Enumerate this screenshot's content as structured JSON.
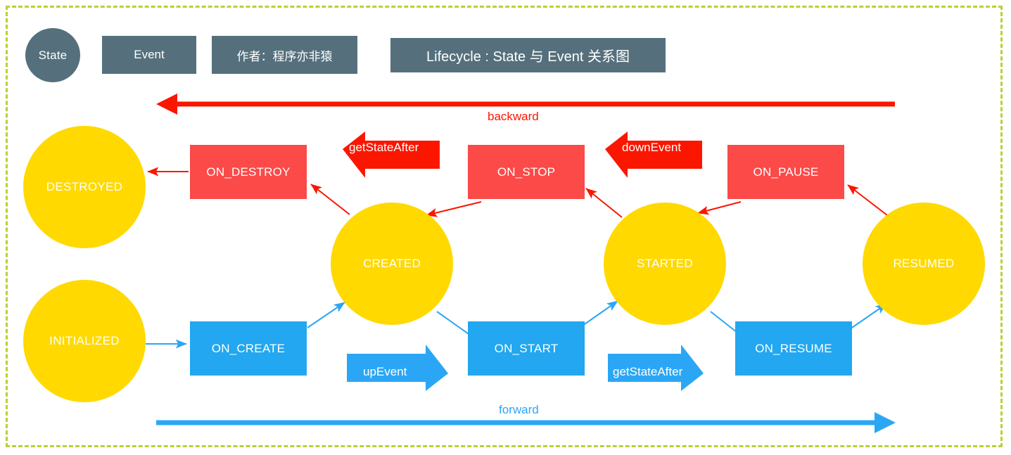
{
  "diagram": {
    "title": "Lifecycle : State 与 Event 关系图",
    "author": "作者：程序亦非猿",
    "border_color": "#b6d335",
    "legend": {
      "state_label": "State",
      "event_label": "Event",
      "legend_color": "#55707c"
    },
    "colors": {
      "state_fill": "#ffd900",
      "event_red": "#fb4a48",
      "event_blue": "#22a7f0",
      "arrow_red": "#fb1600",
      "arrow_blue": "#2ba6f5"
    },
    "direction_labels": {
      "backward": "backward",
      "forward": "forward"
    },
    "states": [
      {
        "id": "destroyed",
        "label": "DESTROYED"
      },
      {
        "id": "initialized",
        "label": "INITIALIZED"
      },
      {
        "id": "created",
        "label": "CREATED"
      },
      {
        "id": "started",
        "label": "STARTED"
      },
      {
        "id": "resumed",
        "label": "RESUMED"
      }
    ],
    "events_backward": [
      {
        "id": "on_destroy",
        "label": "ON_DESTROY"
      },
      {
        "id": "on_stop",
        "label": "ON_STOP"
      },
      {
        "id": "on_pause",
        "label": "ON_PAUSE"
      }
    ],
    "events_forward": [
      {
        "id": "on_create",
        "label": "ON_CREATE"
      },
      {
        "id": "on_start",
        "label": "ON_START"
      },
      {
        "id": "on_resume",
        "label": "ON_RESUME"
      }
    ],
    "block_arrows": [
      {
        "id": "getstateafter_top",
        "label": "getStateAfter",
        "direction": "left",
        "color": "#fb1600"
      },
      {
        "id": "downevent",
        "label": "downEvent",
        "direction": "left",
        "color": "#fb1600"
      },
      {
        "id": "upevent",
        "label": "upEvent",
        "direction": "right",
        "color": "#2ba6f5"
      },
      {
        "id": "getstateafter_bottom",
        "label": "getStateAfter",
        "direction": "right",
        "color": "#2ba6f5"
      }
    ],
    "transitions": [
      {
        "from": "on_destroy",
        "to": "destroyed",
        "flow": "backward"
      },
      {
        "from": "created",
        "to": "on_destroy",
        "flow": "backward"
      },
      {
        "from": "on_stop",
        "to": "created",
        "flow": "backward"
      },
      {
        "from": "started",
        "to": "on_stop",
        "flow": "backward"
      },
      {
        "from": "on_pause",
        "to": "started",
        "flow": "backward"
      },
      {
        "from": "resumed",
        "to": "on_pause",
        "flow": "backward"
      },
      {
        "from": "initialized",
        "to": "on_create",
        "flow": "forward"
      },
      {
        "from": "on_create",
        "to": "created",
        "flow": "forward"
      },
      {
        "from": "created",
        "to": "on_start",
        "flow": "forward"
      },
      {
        "from": "on_start",
        "to": "started",
        "flow": "forward"
      },
      {
        "from": "started",
        "to": "on_resume",
        "flow": "forward"
      },
      {
        "from": "on_resume",
        "to": "resumed",
        "flow": "forward"
      }
    ]
  }
}
